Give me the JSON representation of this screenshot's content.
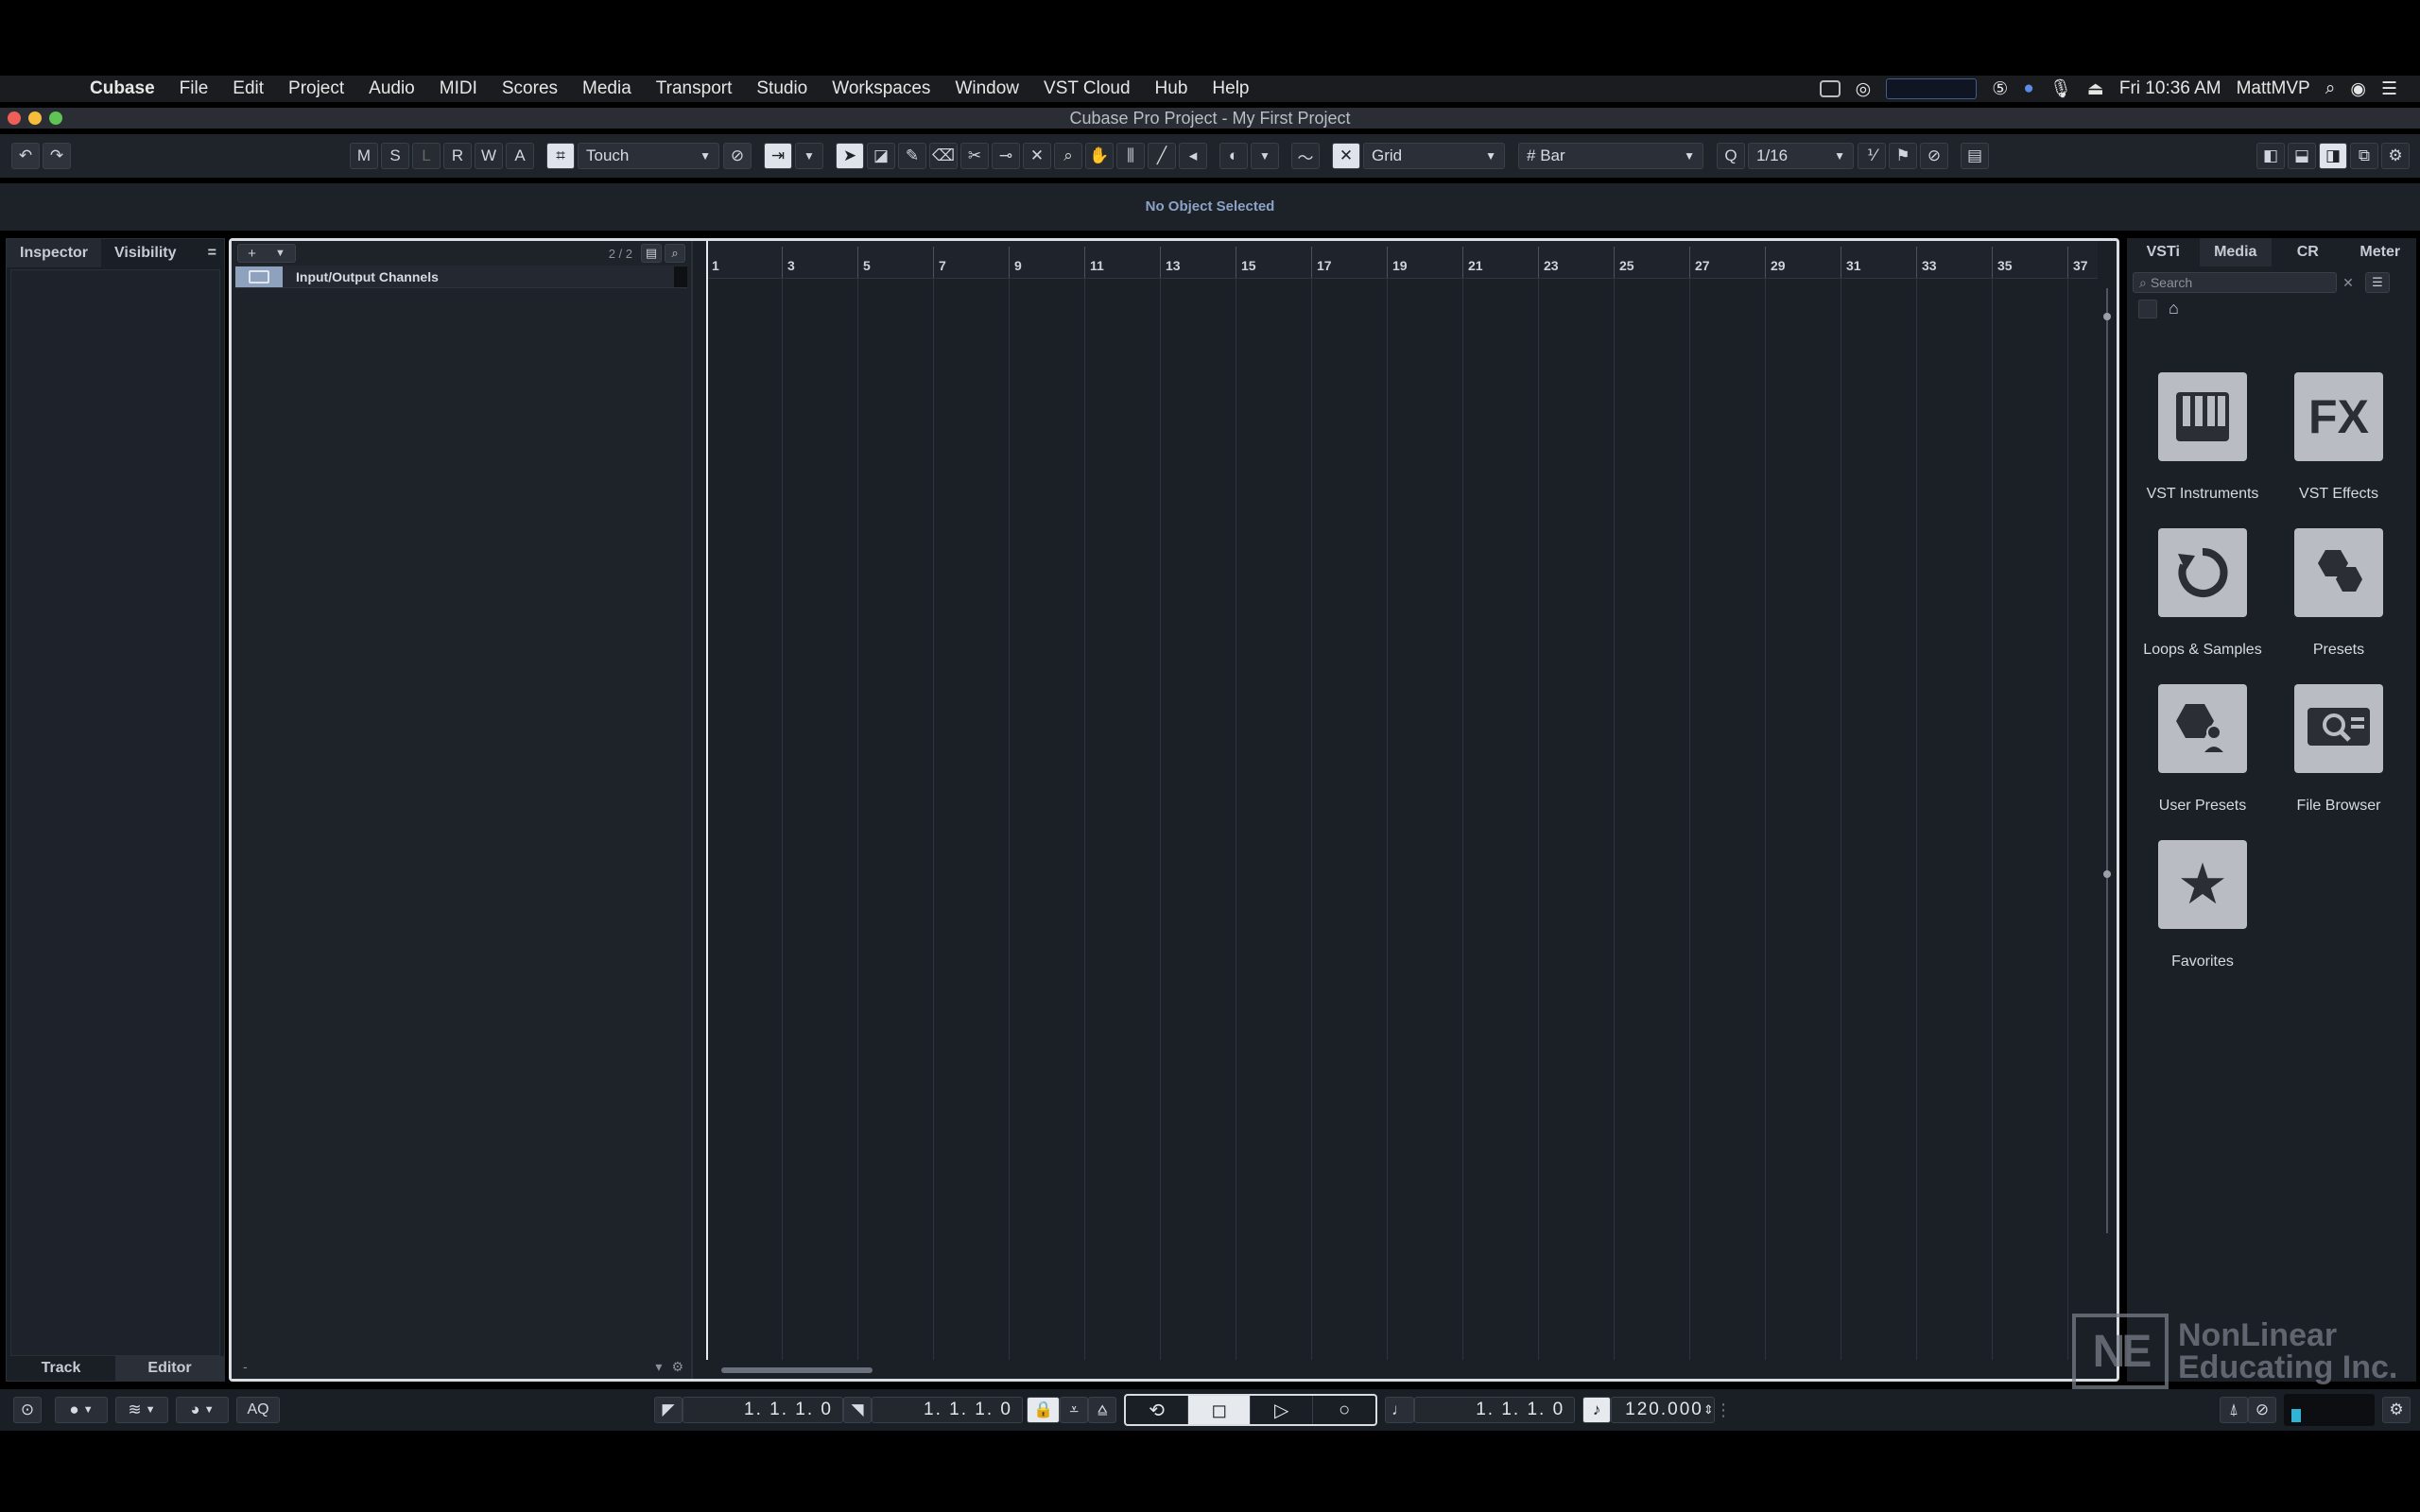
{
  "menubar": {
    "items": [
      "Cubase",
      "File",
      "Edit",
      "Project",
      "Audio",
      "MIDI",
      "Scores",
      "Media",
      "Transport",
      "Studio",
      "Workspaces",
      "Window",
      "VST Cloud",
      "Hub",
      "Help"
    ],
    "clock": "Fri 10:36 AM",
    "user": "MattMVP"
  },
  "window": {
    "title": "Cubase Pro Project - My First Project"
  },
  "toolbar": {
    "state_buttons": [
      "M",
      "S",
      "L",
      "R",
      "W",
      "A"
    ],
    "automation_mode": "Touch",
    "snap_type": "Grid",
    "grid_type": "Bar",
    "quantize": "1/16"
  },
  "infoline": {
    "text": "No Object Selected"
  },
  "inspector": {
    "tabs": [
      "Inspector",
      "Visibility"
    ],
    "bottom_tabs": [
      "Track",
      "Editor"
    ]
  },
  "tracklist": {
    "count": "2 / 2",
    "tracks": [
      {
        "name": "Input/Output Channels"
      }
    ]
  },
  "ruler": {
    "bars": [
      "1",
      "3",
      "5",
      "7",
      "9",
      "11",
      "13",
      "15",
      "17",
      "19",
      "21",
      "23",
      "25",
      "27",
      "29",
      "31",
      "33",
      "35",
      "37"
    ]
  },
  "rightzone": {
    "tabs": [
      "VSTi",
      "Media",
      "CR",
      "Meter"
    ],
    "search_placeholder": "Search",
    "tiles": [
      {
        "label": "VST Instruments",
        "icon": "piano-keys-icon"
      },
      {
        "label": "VST Effects",
        "icon": "fx-icon"
      },
      {
        "label": "Loops & Samples",
        "icon": "loop-icon"
      },
      {
        "label": "Presets",
        "icon": "hexagons-icon"
      },
      {
        "label": "User Presets",
        "icon": "user-hexagon-icon"
      },
      {
        "label": "File Browser",
        "icon": "file-browser-icon"
      },
      {
        "label": "Favorites",
        "icon": "star-icon"
      }
    ]
  },
  "watermark": {
    "mark": "NE",
    "line1": "NonLinear",
    "line2": "Educating Inc."
  },
  "transport": {
    "aq_label": "AQ",
    "left_locator": "1. 1. 1.   0",
    "right_locator": "1. 1. 1.   0",
    "position": "1. 1. 1.   0",
    "tempo": "120.000"
  },
  "colors": {
    "accent": "#8ba3c7",
    "folder": "#8ea2bd",
    "meter": "#2fb4d6"
  }
}
